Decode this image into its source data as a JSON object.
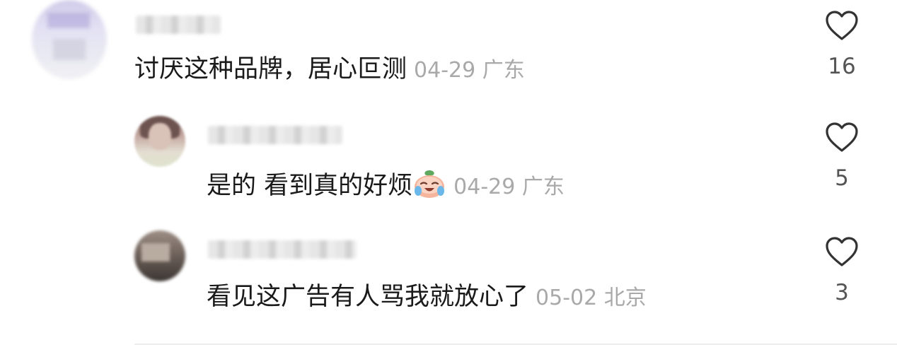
{
  "comments": [
    {
      "text": "讨厌这种品牌，居心叵测",
      "date": "04-29",
      "location": "广东",
      "likes": "16"
    }
  ],
  "replies": [
    {
      "text": "是的 看到真的好烦",
      "emoji": "crying-laughing-peach-emoji",
      "date": "04-29",
      "location": "广东",
      "likes": "5"
    },
    {
      "text": "看见这广告有人骂我就放心了",
      "date": "05-02",
      "location": "北京",
      "likes": "3"
    }
  ],
  "icons": {
    "like": "heart-outline-icon"
  },
  "colors": {
    "text": "#1a1a1a",
    "meta": "#a9a9a9",
    "count": "#555555"
  }
}
